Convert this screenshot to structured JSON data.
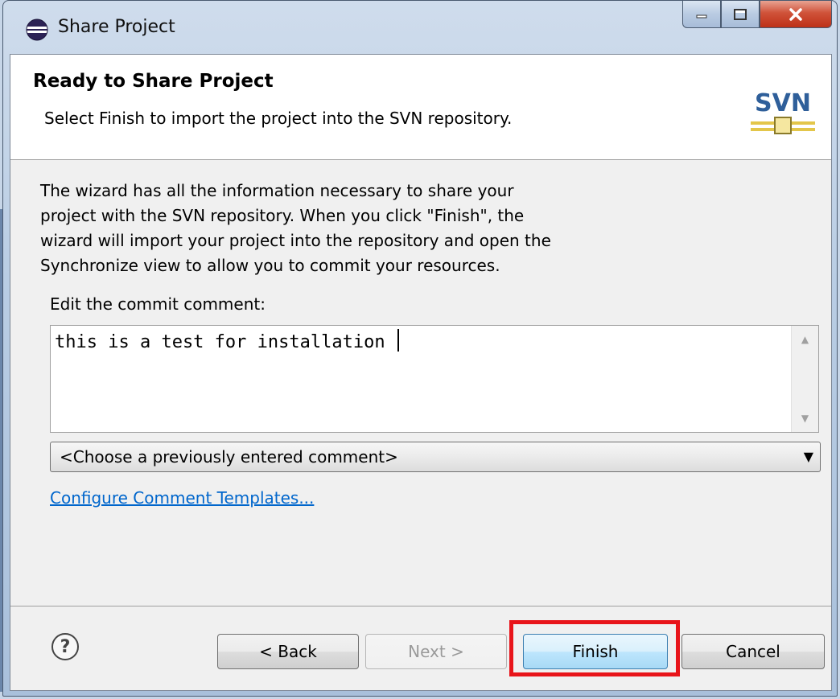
{
  "window": {
    "title": "Share Project"
  },
  "header": {
    "title": "Ready to Share Project",
    "subtitle": "Select Finish to import the project into the SVN repository.",
    "logo_text": "SVN"
  },
  "description": [
    "The wizard has all the information necessary to share your",
    "project with the SVN repository. When you click \"Finish\", the",
    "wizard will import your project into the repository and open the",
    "Synchronize view to allow you to commit your resources."
  ],
  "commit": {
    "label": "Edit the commit comment:",
    "value": "this is a test for installation ",
    "previous_comment_placeholder": "<Choose a previously entered comment>"
  },
  "link": {
    "label": "Configure Comment Templates..."
  },
  "buttons": {
    "back": "< Back",
    "next": "Next >",
    "finish": "Finish",
    "cancel": "Cancel"
  },
  "colors": {
    "highlight": "#e8141a",
    "link": "#0066cc",
    "finish_border": "#3c7fb1"
  }
}
